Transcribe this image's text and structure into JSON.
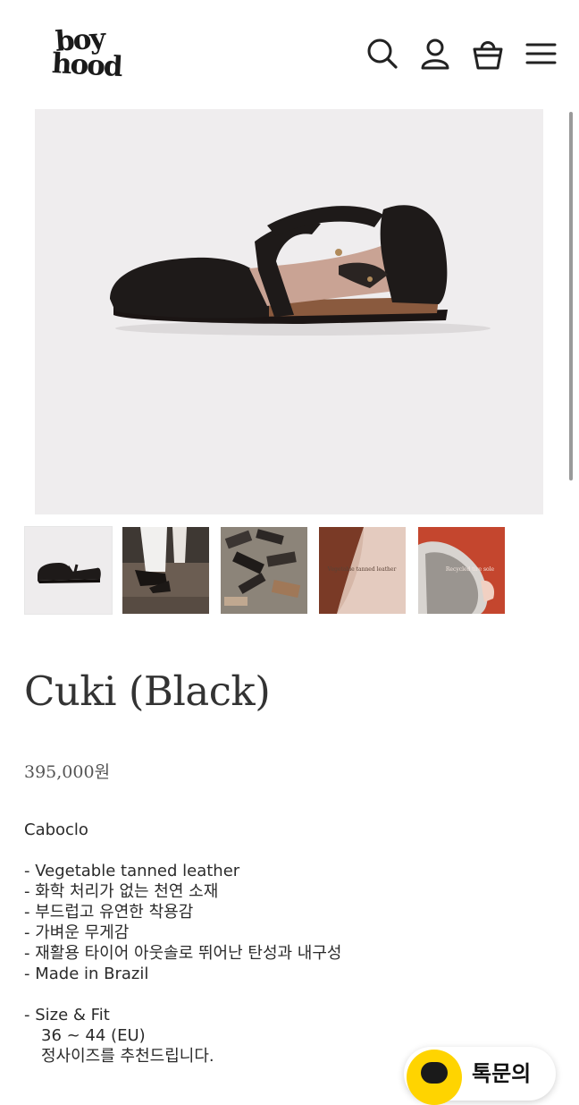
{
  "header": {
    "logo_line1": "boy",
    "logo_line2": "hood",
    "icons": [
      "search-icon",
      "account-icon",
      "shopping-bag-icon",
      "menu-icon"
    ]
  },
  "gallery": {
    "main_image": "black leather shoe side view",
    "thumbnails": [
      {
        "name": "black leather shoe side view"
      },
      {
        "name": "worn on feet with white trousers"
      },
      {
        "name": "shoes in workshop"
      },
      {
        "name": "leather detail with brand mark",
        "overlay": "Vegetable tanned leather"
      },
      {
        "name": "recycled tire sole",
        "overlay": "Recycled tire sole"
      }
    ]
  },
  "product": {
    "title": "Cuki (Black)",
    "price": "395,000원"
  },
  "description": {
    "brand": "Caboclo",
    "features": [
      "- Vegetable tanned leather",
      "- 화학 처리가 없는 천연 소재",
      "- 부드럽고 유연한 착용감",
      "- 가벼운 무게감",
      "- 재활용 타이어 아웃솔로 뛰어난 탄성과 내구성",
      "- Made in Brazil"
    ],
    "size_title": "- Size & Fit",
    "size_range": "36 ~ 44 (EU)",
    "size_note": "정사이즈를 추천드립니다."
  },
  "chat": {
    "label": "톡문의"
  },
  "colors": {
    "chat_accent": "#ffd400",
    "image_bg": "#efedee"
  }
}
